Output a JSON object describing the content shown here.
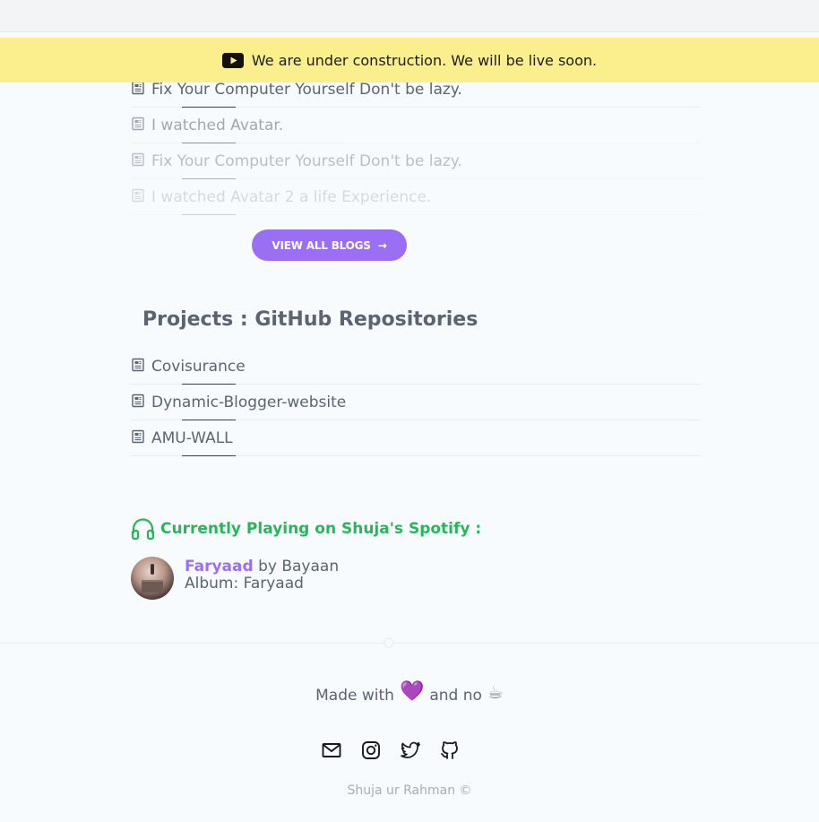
{
  "banner": {
    "icon": "youtube-icon",
    "text": "We are under construction. We will be live soon."
  },
  "blogs": {
    "items": [
      {
        "title": "Fix Your Computer Yourself Don't be lazy."
      },
      {
        "title": "I watched Avatar."
      },
      {
        "title": "Fix Your Computer Yourself Don't be lazy."
      },
      {
        "title": "I watched Avatar 2 a life Experience."
      }
    ],
    "view_all_label": "VIEW ALL BLOGS",
    "view_all_arrow": "→"
  },
  "projects": {
    "title": "Projects : GitHub Repositories",
    "items": [
      {
        "name": "Covisurance"
      },
      {
        "name": "Dynamic-Blogger-website"
      },
      {
        "name": "AMU-WALL"
      }
    ]
  },
  "spotify": {
    "heading": "Currently Playing on Shuja's Spotify :",
    "track": "Faryaad",
    "by_label": "by",
    "artist": "Bayaan",
    "album_label": "Album:",
    "album": "Faryaad"
  },
  "footer": {
    "made_with": "Made with",
    "heart": "💜",
    "and_no": "and no",
    "coffee": "☕",
    "socials": [
      "mail-icon",
      "instagram-icon",
      "twitter-icon",
      "github-icon"
    ],
    "copyright": "Shuja ur Rahman ©"
  },
  "colors": {
    "accent": "#9a6ff4",
    "spotify_green": "#2bb55a",
    "banner_bg": "#fbee8d"
  }
}
